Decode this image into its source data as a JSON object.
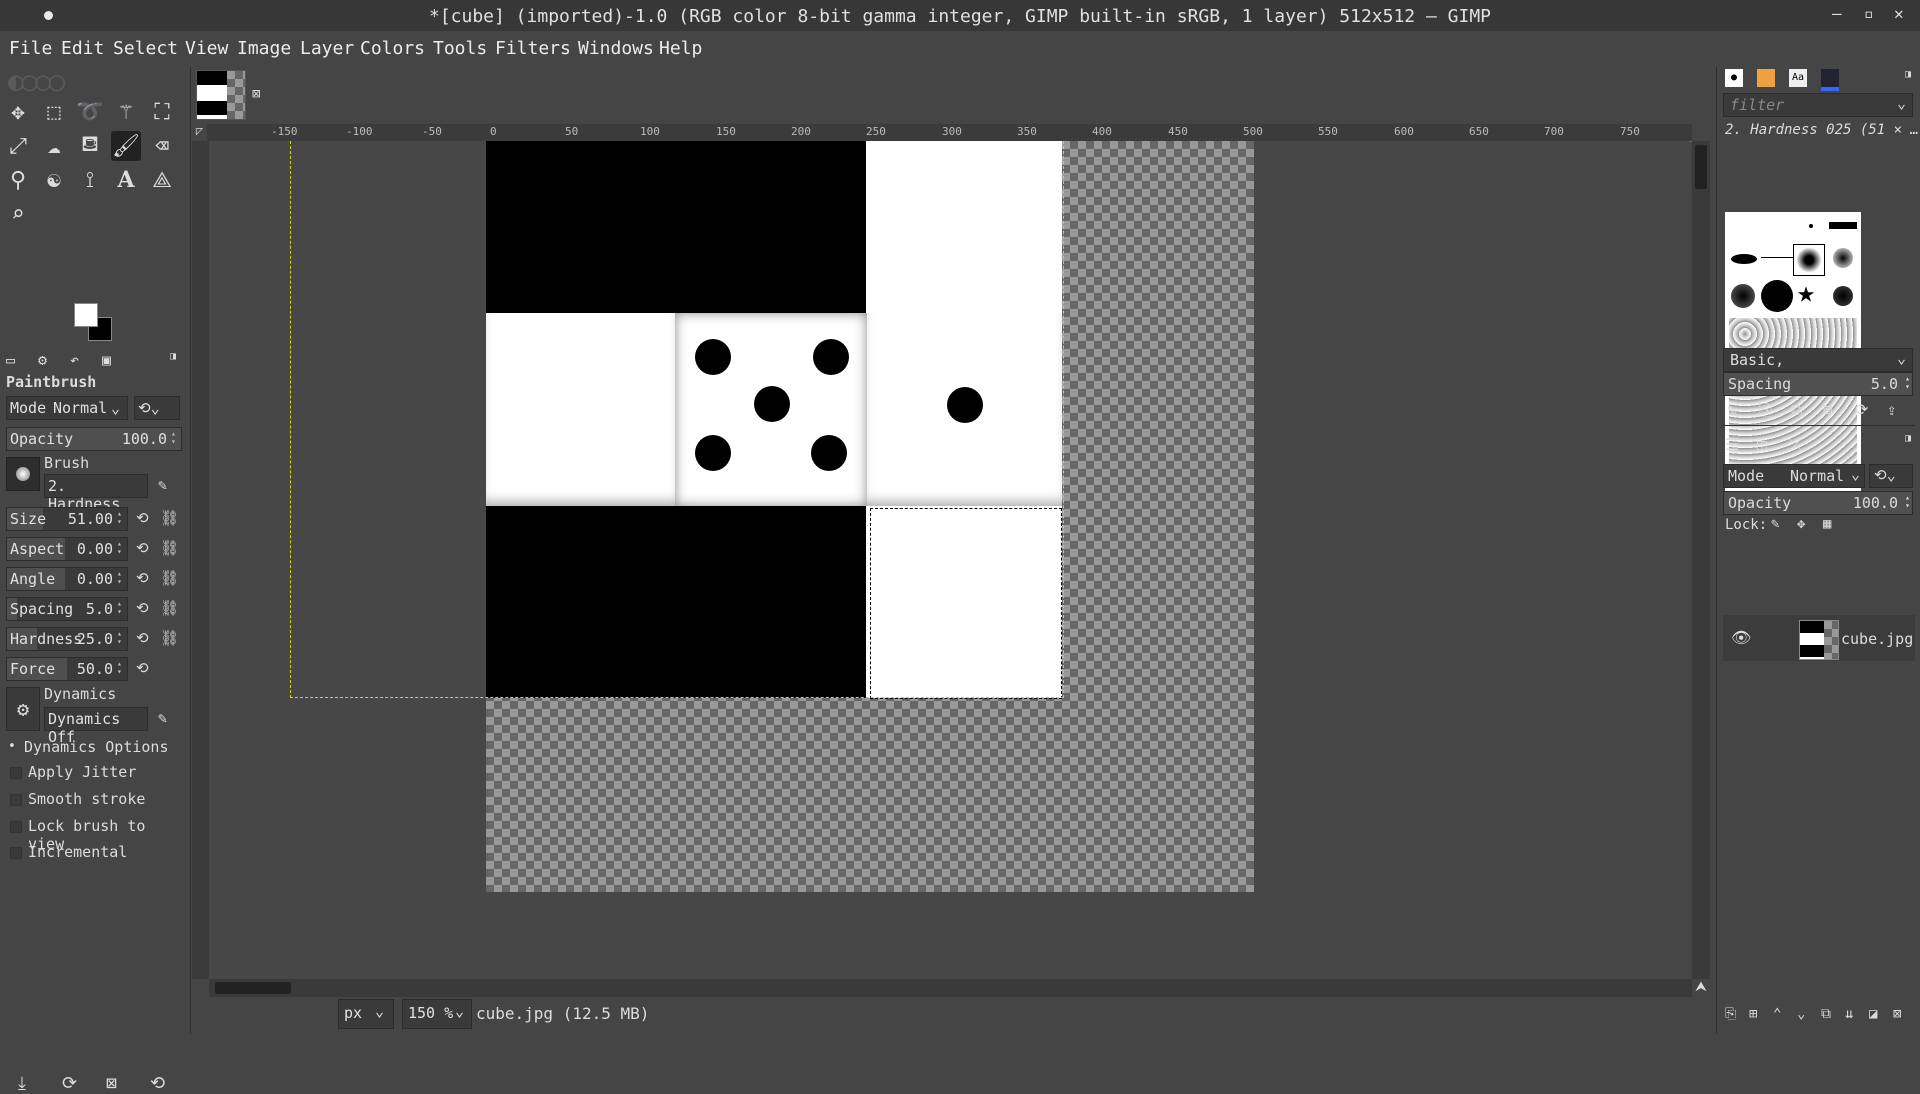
{
  "window": {
    "title": "*[cube] (imported)-1.0 (RGB color 8-bit gamma integer, GIMP built-in sRGB, 1 layer) 512x512 – GIMP",
    "minimize": "–",
    "maximize": "▫",
    "close": "✕"
  },
  "menu": [
    "File",
    "Edit",
    "Select",
    "View",
    "Image",
    "Layer",
    "Colors",
    "Tools",
    "Filters",
    "Windows",
    "Help"
  ],
  "tool_options": {
    "tool_name": "Paintbrush",
    "mode_label": "Mode",
    "mode_value": "Normal",
    "opacity_label": "Opacity",
    "opacity_value": "100.0",
    "brush_label": "Brush",
    "brush_value": "2. Hardness",
    "size_label": "Size",
    "size_value": "51.00",
    "aspect_label": "Aspect",
    "aspect_value": "0.00",
    "angle_label": "Angle",
    "angle_value": "0.00",
    "spacing_label": "Spacing",
    "spacing_value": "5.0",
    "hardness_label": "Hardness",
    "hardness_value": "25.0",
    "force_label": "Force",
    "force_value": "50.0",
    "dynamics_label": "Dynamics",
    "dynamics_value": "Dynamics Off",
    "dynamics_options": "Dynamics Options",
    "apply_jitter": "Apply Jitter",
    "smooth_stroke": "Smooth stroke",
    "lock_brush": "Lock brush to view",
    "incremental": "Incremental"
  },
  "ruler": {
    "h_ticks": [
      "-150",
      "-100",
      "-50",
      "0",
      "50",
      "100",
      "150",
      "200",
      "250",
      "300",
      "350",
      "400",
      "450",
      "500",
      "550",
      "600",
      "650",
      "700",
      "750"
    ]
  },
  "status": {
    "unit": "px",
    "zoom": "150 %",
    "file_info": "cube.jpg (12.5 MB)"
  },
  "brushes": {
    "filter_placeholder": "filter",
    "selected": "2. Hardness 025 (51 × …",
    "tag": "Basic,",
    "spacing_label": "Spacing",
    "spacing_value": "5.0"
  },
  "layers": {
    "mode_label": "Mode",
    "mode_value": "Normal",
    "opacity_label": "Opacity",
    "opacity_value": "100.0",
    "lock_label": "Lock:",
    "layer_name": "cube.jpg"
  }
}
